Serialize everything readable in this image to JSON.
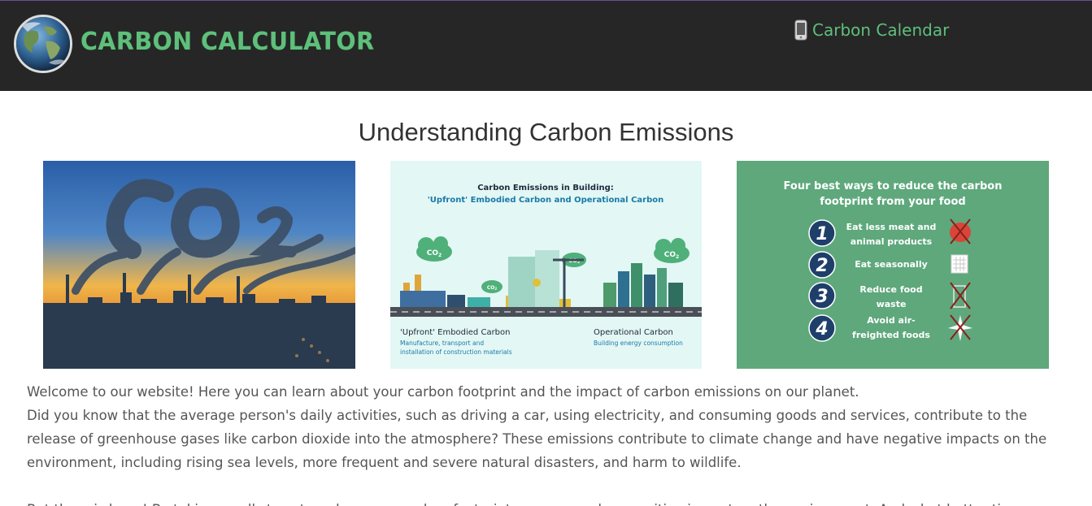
{
  "header": {
    "title": "Carbon Calculator",
    "nav_link": "Carbon Calendar",
    "logo_icon": "globe-icon",
    "nav_icon": "phone-icon"
  },
  "main": {
    "heading": "Understanding Carbon Emissions",
    "images": {
      "co2_smoke": {
        "icon": "co2-smoke-photo"
      },
      "building": {
        "title": "Carbon Emissions in Building:",
        "subtitle": "'Upfront' Embodied Carbon and Operational Carbon",
        "left_label": "'Upfront' Embodied Carbon",
        "left_desc_1": "Manufacture, transport and",
        "left_desc_2": "installation of construction materials",
        "right_label": "Operational Carbon",
        "right_desc": "Building energy consumption",
        "co2": "CO",
        "co2_sub": "2"
      },
      "food": {
        "title_1": "Four best ways to reduce the carbon",
        "title_2": "footprint from your food",
        "items": [
          {
            "num": "1",
            "line1": "Eat less meat and",
            "line2": "animal products"
          },
          {
            "num": "2",
            "line1": "Eat seasonally",
            "line2": ""
          },
          {
            "num": "3",
            "line1": "Reduce food",
            "line2": "waste"
          },
          {
            "num": "4",
            "line1": "Avoid air-",
            "line2": "freighted foods"
          }
        ]
      }
    },
    "intro_p1": "Welcome to our website! Here you can learn about your carbon footprint and the impact of carbon emissions on our planet.",
    "intro_p2": "Did you know that the average person's daily activities, such as driving a car, using electricity, and consuming goods and services, contribute to the release of greenhouse gases like carbon dioxide into the atmosphere? These emissions contribute to climate change and have negative impacts on the environment, including rising sea levels, more frequent and severe natural disasters, and harm to wildlife.",
    "intro_p3": "But there is hope! By taking small steps to reduce your carbon footprint, you can make a positive impact on the environment. And what better time"
  },
  "colors": {
    "header_bg": "#262626",
    "brand_green": "#5fbf7b",
    "food_card_bg": "#5ea87c",
    "food_number_circle": "#1f3f6b"
  }
}
